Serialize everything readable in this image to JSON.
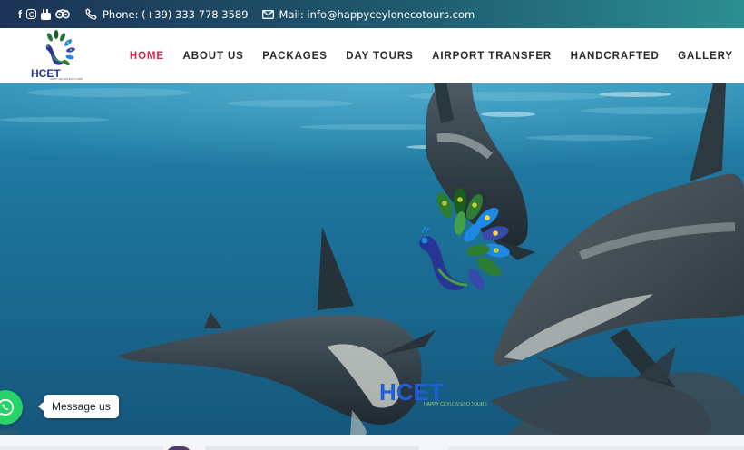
{
  "topbar": {
    "social_icons": [
      "facebook-icon",
      "instagram-icon",
      "youtube-icon",
      "tripadvisor-icon"
    ],
    "phone_text": "Phone: (+39) 333 778 3589",
    "mail_text": "Mail: info@happyceylonecotours.com"
  },
  "brand": {
    "logo_text": "HCET",
    "logo_subtext": "HAPPY CEYLON ECO TOURS"
  },
  "nav": {
    "items": [
      {
        "label": "HOME",
        "active": true
      },
      {
        "label": "ABOUT US",
        "active": false
      },
      {
        "label": "PACKAGES",
        "active": false
      },
      {
        "label": "DAY TOURS",
        "active": false
      },
      {
        "label": "AIRPORT TRANSFER",
        "active": false
      },
      {
        "label": "HANDCRAFTED",
        "active": false
      },
      {
        "label": "GALLERY",
        "active": false
      }
    ]
  },
  "hero": {
    "logo_text": "HCET",
    "logo_subtext": "HAPPY CEYLON ECO TOURS"
  },
  "whatsapp": {
    "message_label": "Message us",
    "button_label": "tButton"
  },
  "colors": {
    "accent": "#d9264e",
    "nav_text": "#2a2a2a",
    "topbar_start": "#1c3355",
    "topbar_end": "#2b8f92",
    "whatsapp": "#25d366",
    "ocean": "#1c6f96"
  }
}
